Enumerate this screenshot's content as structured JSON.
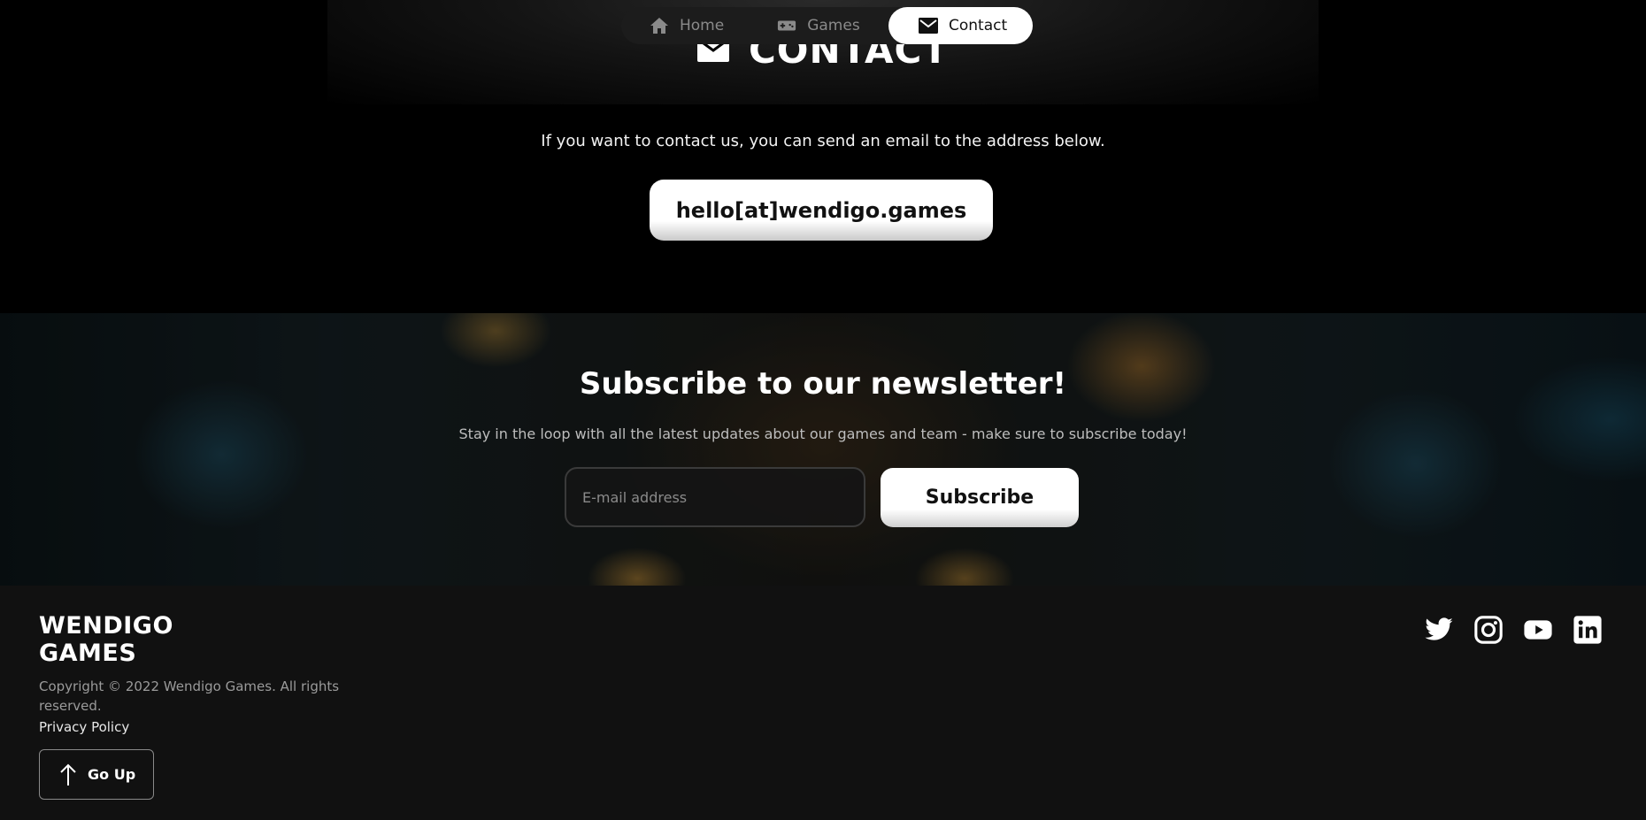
{
  "nav": {
    "items": [
      {
        "label": "Home",
        "icon": "home-icon"
      },
      {
        "label": "Games",
        "icon": "gamepad-icon"
      },
      {
        "label": "Contact",
        "icon": "mail-icon",
        "active": true
      }
    ]
  },
  "contact": {
    "title": "CONTACT",
    "icon": "mail-icon",
    "text": "If you want to contact us, you can send an email to the address below.",
    "email": "hello[at]wendigo.games"
  },
  "newsletter": {
    "title": "Subscribe to our newsletter!",
    "subtitle": "Stay in the loop with all the latest updates about our games and team - make sure to subscribe today!",
    "input_placeholder": "E-mail address",
    "button": "Subscribe"
  },
  "footer": {
    "brand_line1": "WENDIGO",
    "brand_line2": "GAMES",
    "copyright": "Copyright © 2022 Wendigo Games. All rights reserved.",
    "privacy": "Privacy Policy",
    "go_up": "Go Up",
    "socials": [
      "twitter-icon",
      "instagram-icon",
      "youtube-icon",
      "linkedin-icon"
    ]
  },
  "colors": {
    "background": "#000000",
    "footer_bg": "#111111",
    "button_bg": "#ffffff",
    "nav_bg": "#1c1c1c"
  }
}
